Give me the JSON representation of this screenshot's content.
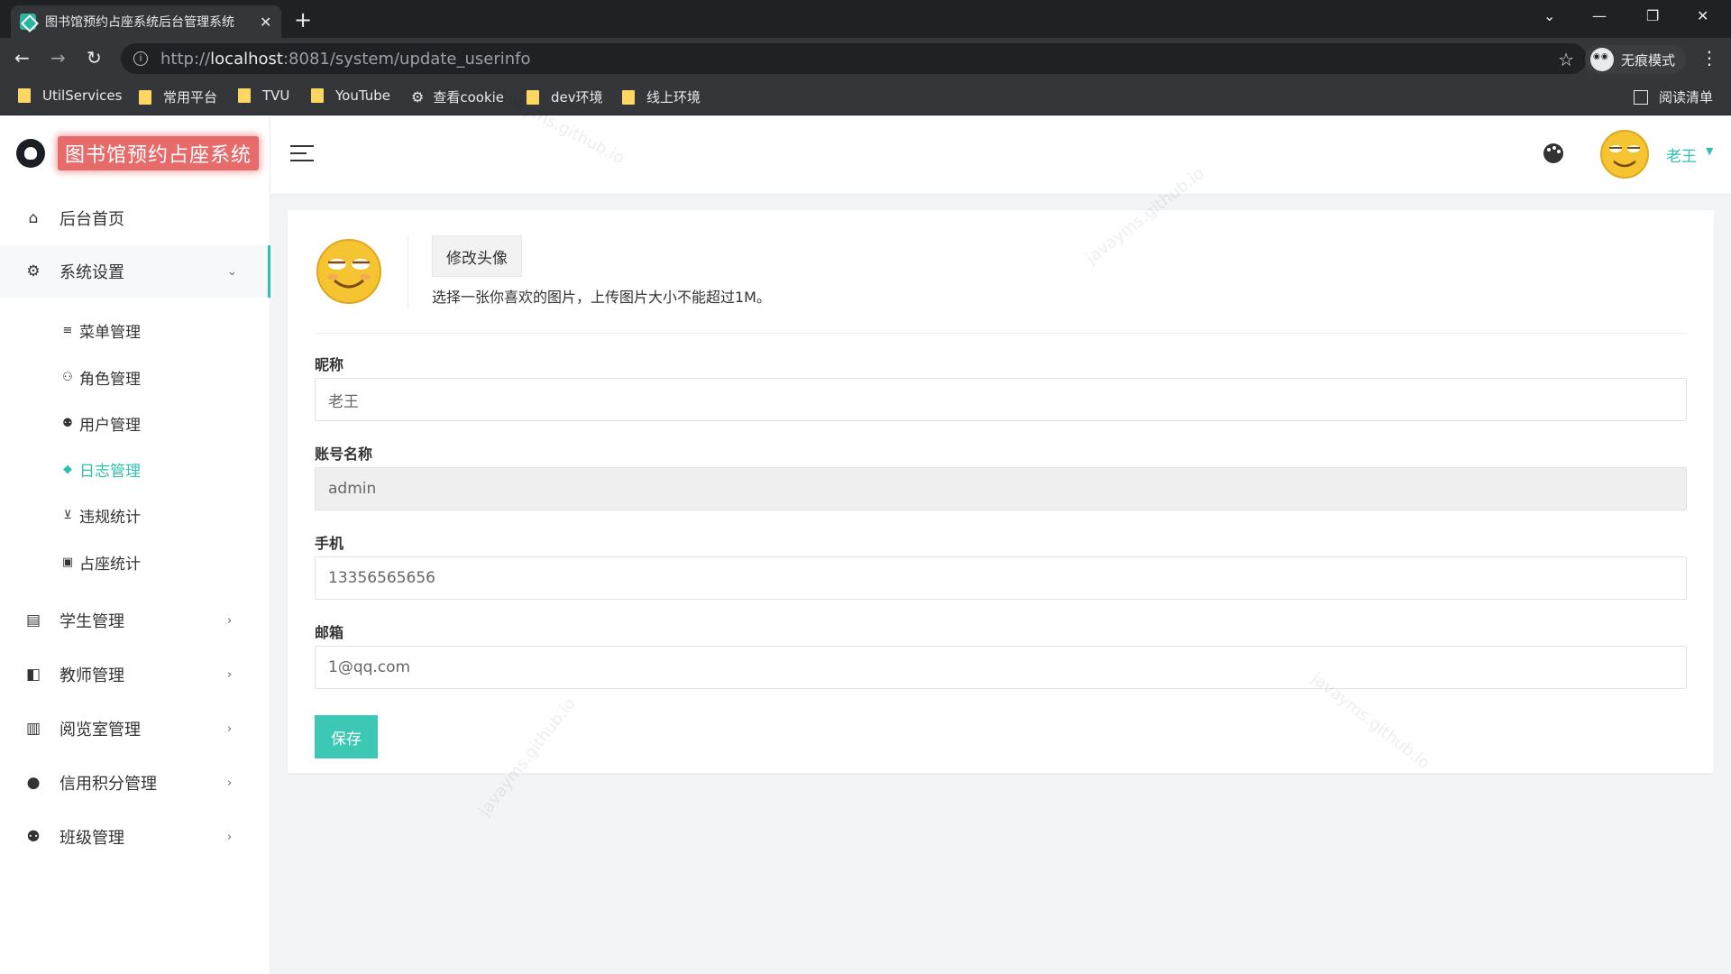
{
  "browser": {
    "tab_title": "图书馆预约占座系统后台管理系统",
    "tab_close": "✕",
    "new_tab": "+",
    "url_scheme": "http://",
    "url_host": "localhost",
    "url_rest": ":8081/system/update_userinfo",
    "incognito_label": "无痕模式",
    "bookmarks": [
      "UtilServices",
      "常用平台",
      "TVU",
      "YouTube",
      "查看cookie",
      "dev环境",
      "线上环境"
    ],
    "reading_list": "阅读清单"
  },
  "app": {
    "brand_title": "图书馆预约占座系统",
    "user_name": "老王"
  },
  "sidebar": {
    "items": [
      {
        "label": "后台首页",
        "icon": "home-icon"
      },
      {
        "label": "系统设置",
        "icon": "gear-icon"
      },
      {
        "label": "学生管理",
        "icon": "student-badge-icon"
      },
      {
        "label": "教师管理",
        "icon": "teacher-icon"
      },
      {
        "label": "阅览室管理",
        "icon": "book-open-icon"
      },
      {
        "label": "信用积分管理",
        "icon": "person-icon"
      },
      {
        "label": "班级管理",
        "icon": "group-icon"
      }
    ],
    "sub_items": [
      {
        "label": "菜单管理",
        "icon": "list-icon"
      },
      {
        "label": "角色管理",
        "icon": "user-role-icon"
      },
      {
        "label": "用户管理",
        "icon": "users-icon"
      },
      {
        "label": "日志管理",
        "icon": "tag-icon"
      },
      {
        "label": "违规统计",
        "icon": "flight-land-icon"
      },
      {
        "label": "占座统计",
        "icon": "seat-icon"
      }
    ]
  },
  "form": {
    "upload_button": "修改头像",
    "upload_hint": "选择一张你喜欢的图片，上传图片大小不能超过1M。",
    "nickname_label": "昵称",
    "nickname_value": "老王",
    "account_label": "账号名称",
    "account_value": "admin",
    "phone_label": "手机",
    "phone_value": "13356565656",
    "email_label": "邮箱",
    "email_value": "1@qq.com",
    "save_button": "保存"
  },
  "watermark": "javayms.github.io",
  "colors": {
    "accent": "#2fc1ad",
    "brand_bg": "#e86b6b",
    "save_bg": "#3cc8b4"
  }
}
